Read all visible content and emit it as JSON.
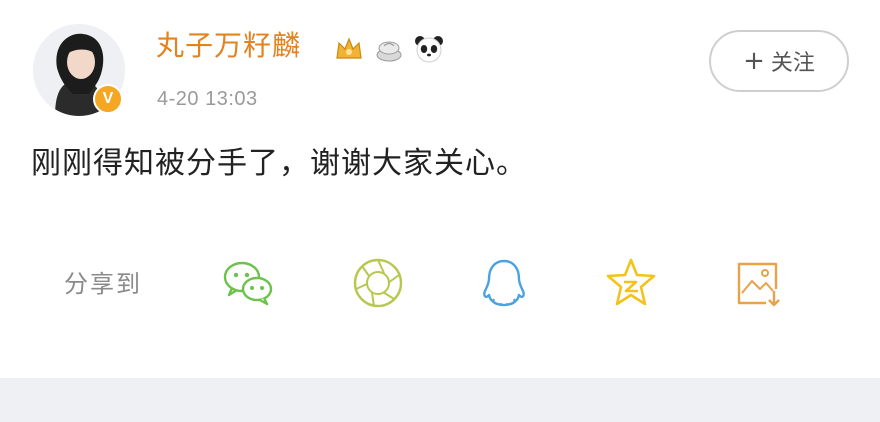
{
  "post": {
    "username": "丸子万籽麟",
    "timestamp": "4-20 13:03",
    "content": "刚刚得知被分手了，谢谢大家关心。",
    "verified_badge": "V",
    "follow_button": {
      "plus": "+",
      "label": "关注"
    }
  },
  "share": {
    "label": "分享到",
    "icons": [
      "wechat-icon",
      "moments-icon",
      "qq-icon",
      "qzone-icon",
      "save-image-icon"
    ]
  },
  "colors": {
    "username": "#e3821f",
    "badge_gold": "#f5a623",
    "wechat_green": "#6cc24a",
    "moments_olive": "#b9c74f",
    "qq_blue": "#4aa3e0",
    "qzone_yellow": "#f4c21a",
    "save_orange": "#e9a24a"
  }
}
